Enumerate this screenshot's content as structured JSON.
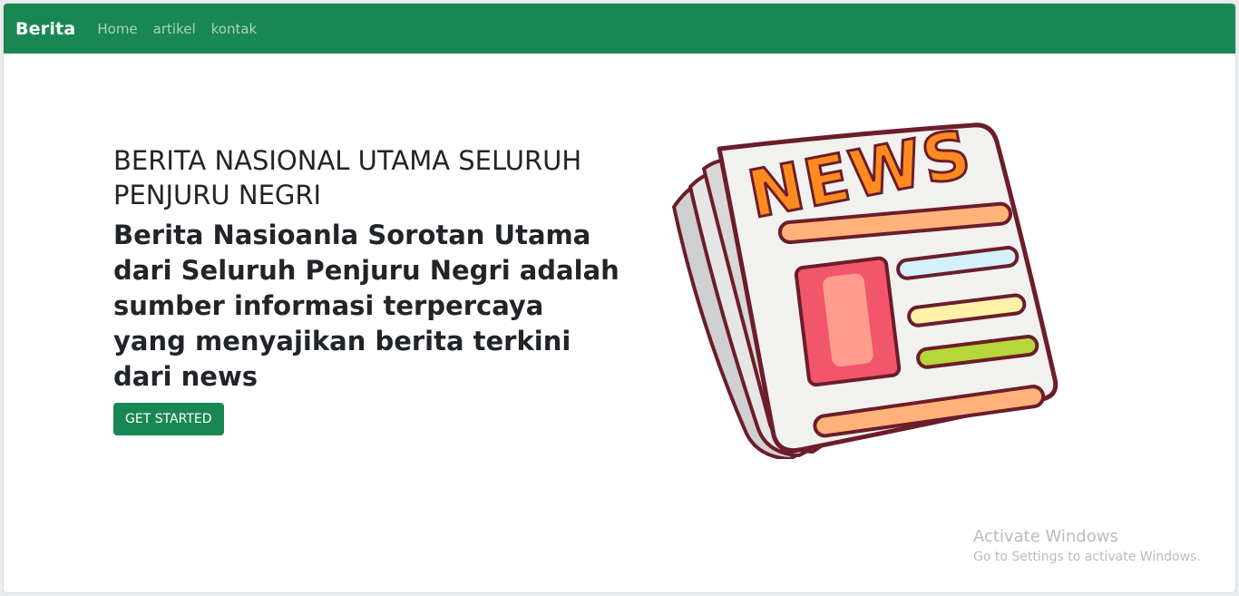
{
  "navbar": {
    "brand": "Berita",
    "links": [
      "Home",
      "artikel",
      "kontak"
    ]
  },
  "hero": {
    "title": "BERITA NASIONAL UTAMA SELURUH PENJURU NEGRI",
    "subtitle": "Berita Nasioanla Sorotan Utama dari Seluruh Penjuru Negri adalah sumber informasi terpercaya yang menyajikan berita terkini dari news",
    "button_label": "GET STARTED",
    "illustration_text": "NEWS"
  },
  "watermark": {
    "title": "Activate Windows",
    "subtitle": "Go to Settings to activate Windows."
  },
  "colors": {
    "navbar": "#198754",
    "button": "#198754"
  }
}
